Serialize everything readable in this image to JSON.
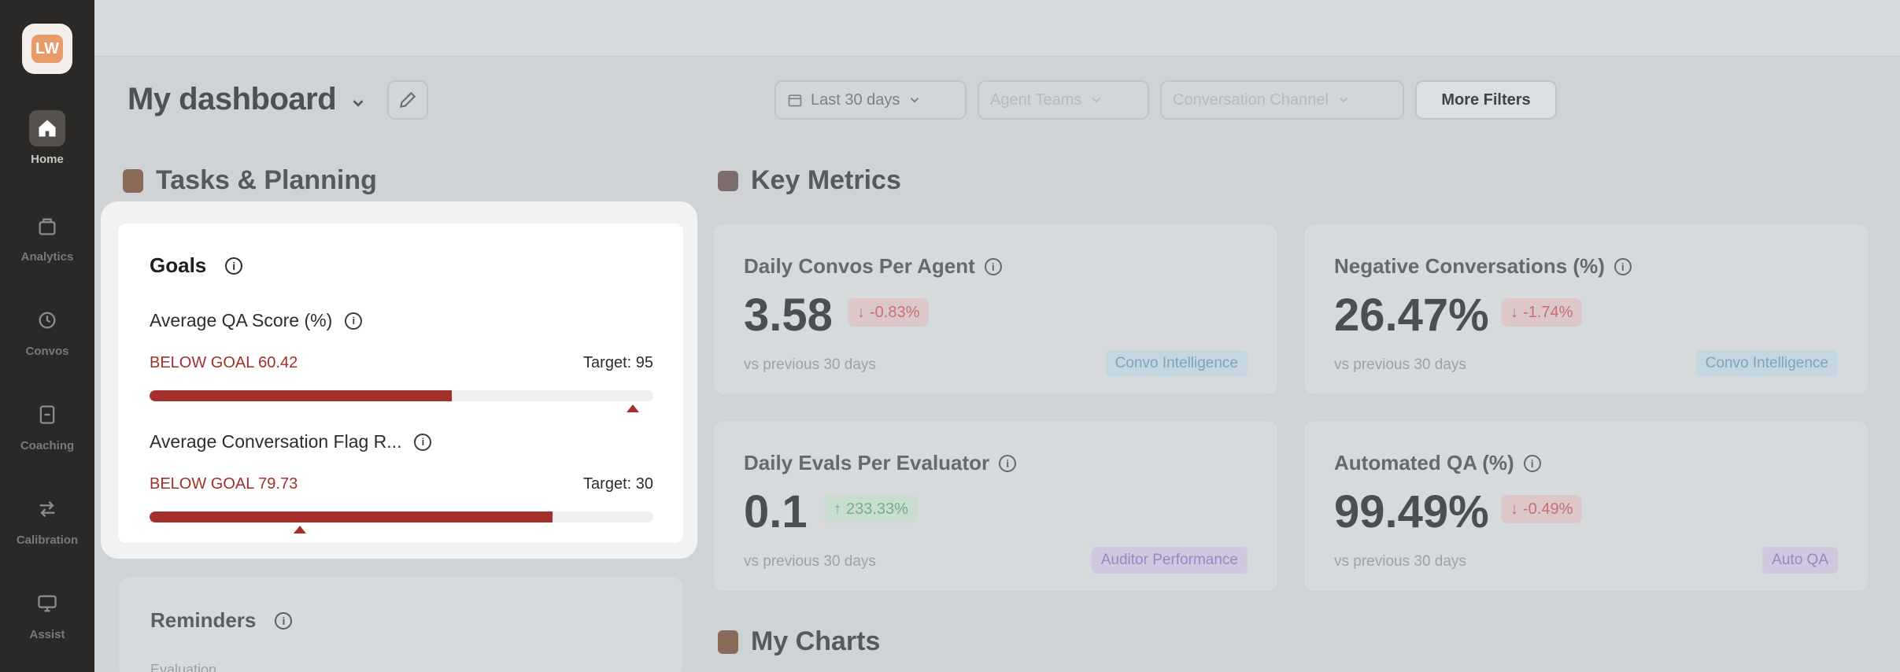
{
  "sidebar": {
    "logo_text": "LW",
    "items": [
      {
        "label": "Home",
        "icon": "home-icon"
      },
      {
        "label": "Analytics",
        "icon": "analytics-icon"
      },
      {
        "label": "Convos",
        "icon": "history-icon"
      },
      {
        "label": "Coaching",
        "icon": "clipboard-icon"
      },
      {
        "label": "Calibration",
        "icon": "arrows-icon"
      },
      {
        "label": "Assist",
        "icon": "monitor-icon"
      }
    ]
  },
  "header": {
    "title": "My dashboard",
    "filters": {
      "date": "Last 30 days",
      "teams": "Agent Teams",
      "channel": "Conversation Channel",
      "more": "More Filters"
    }
  },
  "tasks": {
    "heading": "Tasks & Planning",
    "goals": {
      "title": "Goals",
      "items": [
        {
          "name": "Average QA Score (%)",
          "status": "BELOW GOAL 60.42",
          "target": "Target: 95",
          "value": 60.42,
          "goal": 95,
          "progress": 0.6
        },
        {
          "name": "Average Conversation Flag R...",
          "status": "BELOW GOAL 79.73",
          "target": "Target: 30",
          "value": 79.73,
          "goal": 30,
          "progress": 0.8
        }
      ]
    },
    "reminders": {
      "title": "Reminders",
      "subtitle": "Evaluation"
    }
  },
  "metrics": {
    "heading": "Key Metrics",
    "cards": [
      {
        "label": "Daily Convos Per Agent",
        "value": "3.58",
        "delta": "-0.83%",
        "vs": "vs previous 30 days",
        "tag": "Convo Intelligence"
      },
      {
        "label": "Negative Conversations (%)",
        "value": "26.47%",
        "delta": "-1.74%",
        "vs": "vs previous 30 days",
        "tag": "Convo Intelligence"
      },
      {
        "label": "Daily Evals Per Evaluator",
        "value": "0.1",
        "delta": "233.33%",
        "vs": "vs previous 30 days",
        "tag": "Auditor Performance"
      },
      {
        "label": "Automated QA (%)",
        "value": "99.49%",
        "delta": "-0.49%",
        "vs": "vs previous 30 days",
        "tag": "Auto QA"
      }
    ]
  },
  "charts": {
    "heading": "My Charts"
  },
  "colors": {
    "goal_red": "#a3302b",
    "sidebar": "#2b2927",
    "background": "#cfd3d5"
  }
}
